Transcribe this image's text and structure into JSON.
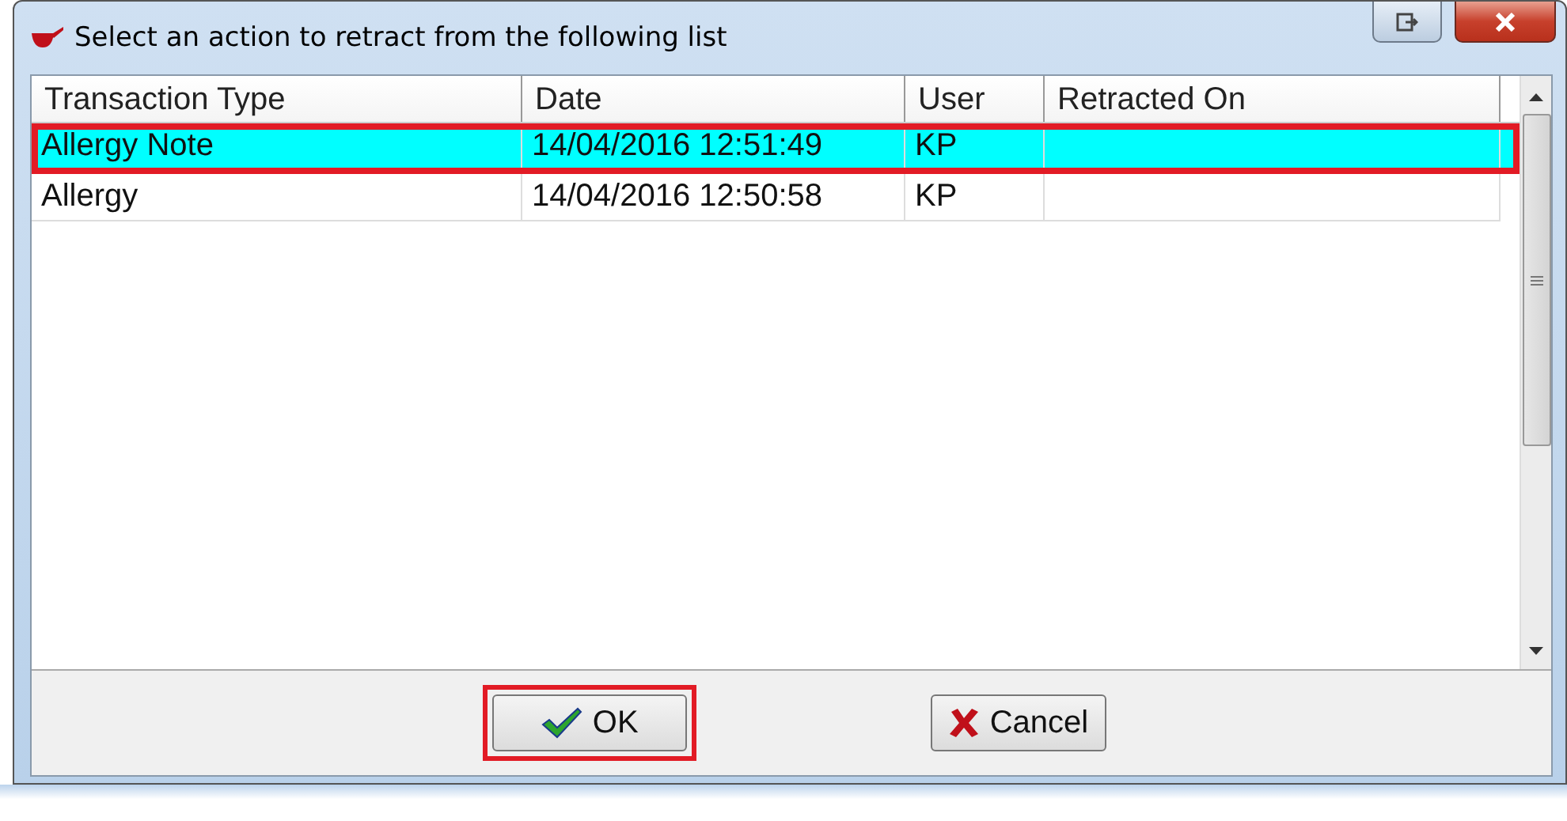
{
  "window": {
    "title": "Select an action to retract from the following list"
  },
  "table": {
    "columns": [
      "Transaction Type",
      "Date",
      "User",
      "Retracted On"
    ],
    "rows": [
      {
        "cells": [
          "Allergy Note",
          "14/04/2016 12:51:49",
          "KP",
          ""
        ],
        "selected": true,
        "highlighted": true
      },
      {
        "cells": [
          "Allergy",
          "14/04/2016 12:50:58",
          "KP",
          ""
        ],
        "selected": false,
        "highlighted": false
      }
    ]
  },
  "buttons": [
    {
      "label": "OK",
      "kind": "ok",
      "highlighted": true
    },
    {
      "label": "Cancel",
      "kind": "cancel",
      "highlighted": false
    }
  ]
}
